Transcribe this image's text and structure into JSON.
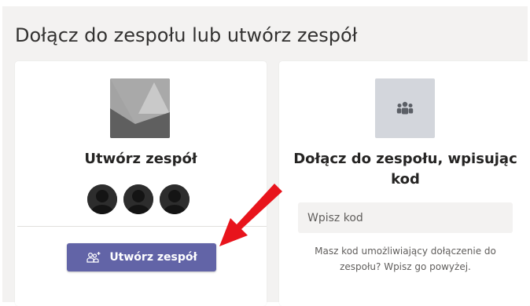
{
  "page": {
    "title": "Dołącz do zespołu lub utwórz zespół"
  },
  "create_card": {
    "title": "Utwórz zespół",
    "button_label": "Utwórz zespół",
    "button_icon": "add-team-icon"
  },
  "join_card": {
    "title": "Dołącz do zespołu, wpisując kod",
    "input_placeholder": "Wpisz kod",
    "input_value": "",
    "hint": "Masz kod umożliwiający dołączenie do zespołu? Wpisz go powyżej.",
    "icon": "team-people-icon"
  },
  "colors": {
    "accent": "#6264a7",
    "background": "#f3f2f1",
    "card": "#ffffff",
    "annotation_arrow": "#e8141c"
  }
}
